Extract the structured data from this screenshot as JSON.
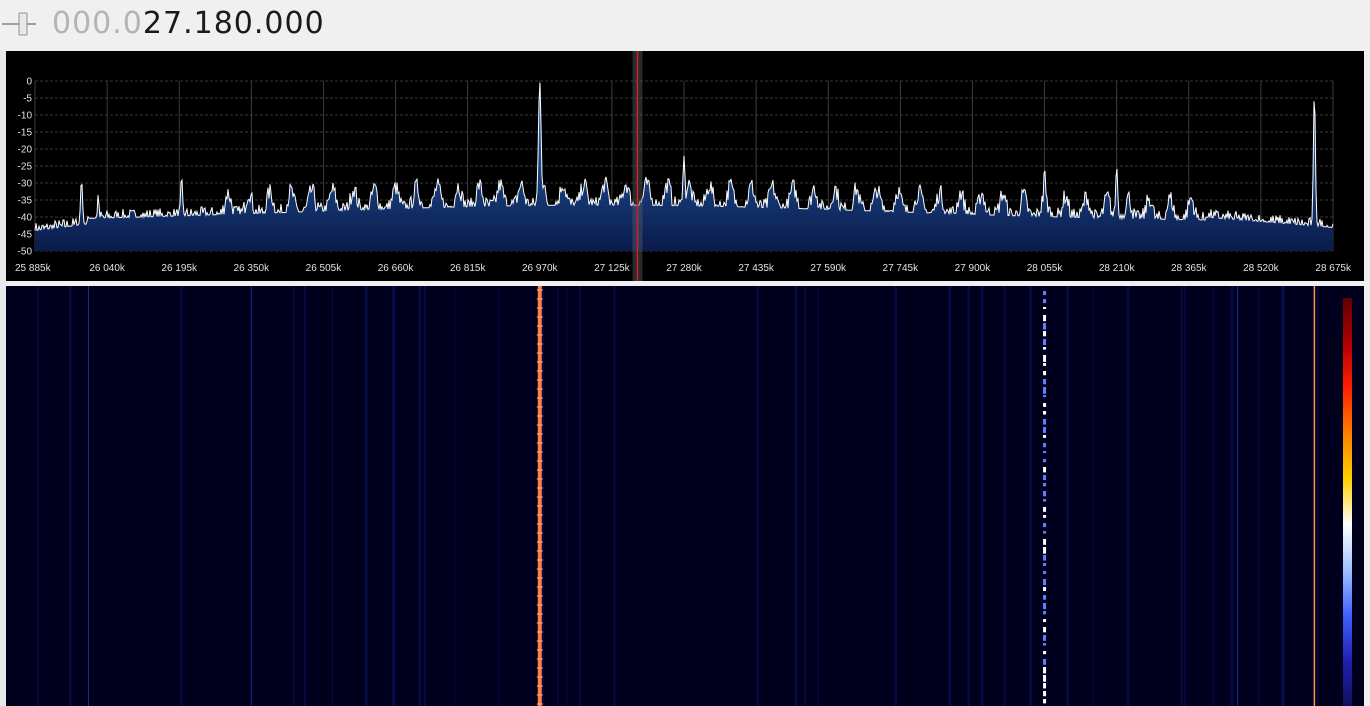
{
  "frequency": {
    "dim_part": "000.0",
    "bright_part": "27.180.000"
  },
  "spectrum": {
    "db_ticks": [
      "0",
      "-5",
      "-10",
      "-15",
      "-20",
      "-25",
      "-30",
      "-35",
      "-40",
      "-45",
      "-50"
    ],
    "db_range": [
      -50,
      0
    ],
    "freq_range_khz": [
      25885,
      28675
    ],
    "freq_tick_values_khz": [
      25885,
      26040,
      26195,
      26350,
      26505,
      26660,
      26815,
      26970,
      27125,
      27280,
      27435,
      27590,
      27745,
      27900,
      28055,
      28210,
      28365,
      28520,
      28675
    ],
    "freq_ticks": [
      "25 885k",
      "26 040k",
      "26 195k",
      "26 350k",
      "26 505k",
      "26 660k",
      "26 815k",
      "26 970k",
      "27 125k",
      "27 280k",
      "27 435k",
      "27 590k",
      "27 745k",
      "27 900k",
      "28 055k",
      "28 210k",
      "28 365k",
      "28 520k",
      "28 675k"
    ],
    "tuned_khz": 27180,
    "colors": {
      "fill_top": "#2a6fc0",
      "fill_bottom": "#0a1a4a",
      "trace": "#ffffff",
      "grid": "#555555",
      "cursor": "#c02020"
    }
  },
  "waterfall": {
    "colors": {
      "background": "#000020",
      "strong": "#ff8040",
      "white": "#ffffff",
      "blue": "#2040ff"
    },
    "signal_lines_khz": [
      26970,
      28055,
      28635
    ],
    "colorbar": [
      "#600000",
      "#b00000",
      "#ff2000",
      "#ff8000",
      "#ffd000",
      "#ffffff",
      "#a0c0ff",
      "#4060ff",
      "#2020b0",
      "#101060"
    ]
  }
}
